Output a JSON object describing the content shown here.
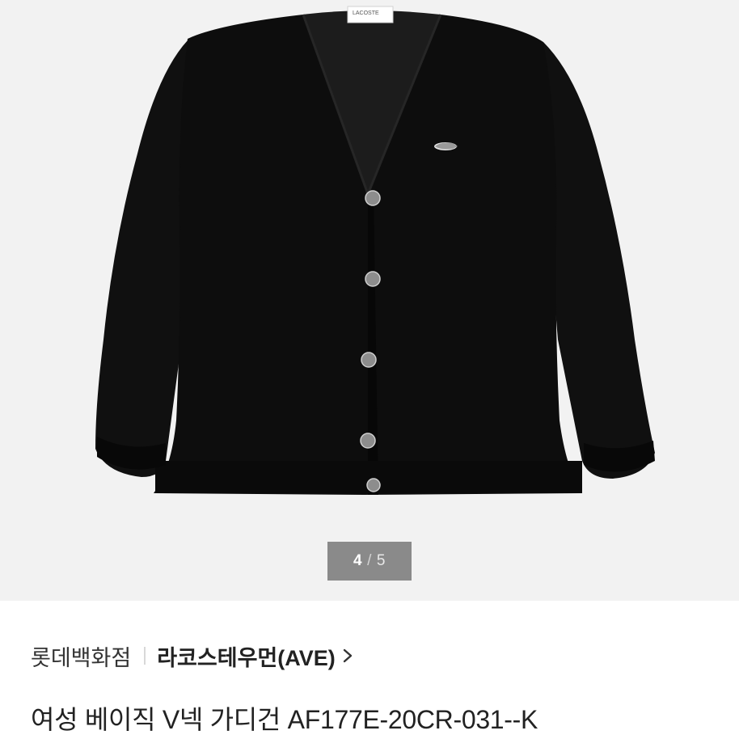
{
  "gallery": {
    "image_alt": "black V-neck cardigan",
    "tag_text": "LACOSTE",
    "pager": {
      "current": "4",
      "separator": "/",
      "total": "5"
    }
  },
  "breadcrumb": {
    "store": "롯데백화점",
    "brand": "라코스테우먼(AVE)"
  },
  "product": {
    "title": "여성 베이직 V넥 가디건 AF177E-20CR-031--K"
  },
  "colors": {
    "gallery_bg": "#f2f2f2",
    "pager_bg": "#8a8a8a",
    "garment": "#0d0d0d"
  }
}
